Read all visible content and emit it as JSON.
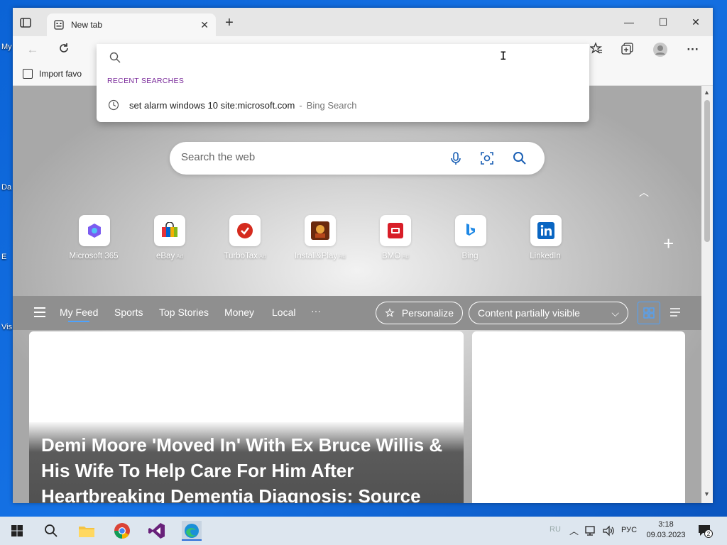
{
  "desktop": {
    "labels": [
      "My",
      "Da",
      "E",
      "Vis"
    ]
  },
  "browser": {
    "tab": {
      "title": "New tab"
    },
    "favorites_bar": {
      "import_label": "Import favo"
    },
    "address_dropdown": {
      "recent_label": "RECENT SEARCHES",
      "recent_items": [
        {
          "query": "set alarm windows 10 site:microsoft.com",
          "separator": "-",
          "source": "Bing Search"
        }
      ]
    }
  },
  "newtab": {
    "search": {
      "placeholder": "Search the web"
    },
    "tiles": [
      {
        "label": "Microsoft 365",
        "ad": ""
      },
      {
        "label": "eBay",
        "ad": "Ad"
      },
      {
        "label": "TurboTax",
        "ad": "Ad"
      },
      {
        "label": "Install&Play",
        "ad": "Ad"
      },
      {
        "label": "BMO",
        "ad": "Ad"
      },
      {
        "label": "Bing",
        "ad": ""
      },
      {
        "label": "LinkedIn",
        "ad": ""
      }
    ],
    "feed": {
      "tabs": [
        "My Feed",
        "Sports",
        "Top Stories",
        "Money",
        "Local"
      ],
      "more": "···",
      "personalize": "Personalize",
      "content_visibility": "Content partially visible"
    },
    "headline": "Demi Moore 'Moved In' With Ex Bruce Willis & His Wife To Help Care For Him After Heartbreaking Dementia Diagnosis: Source"
  },
  "taskbar": {
    "lang_faded": "RU",
    "lang": "РУС",
    "time": "3:18",
    "date": "09.03.2023",
    "notifications": "2"
  },
  "colors": {
    "desktop": "#1673e6",
    "accent": "#4da3ff",
    "recent_label": "#7a2a9a"
  }
}
